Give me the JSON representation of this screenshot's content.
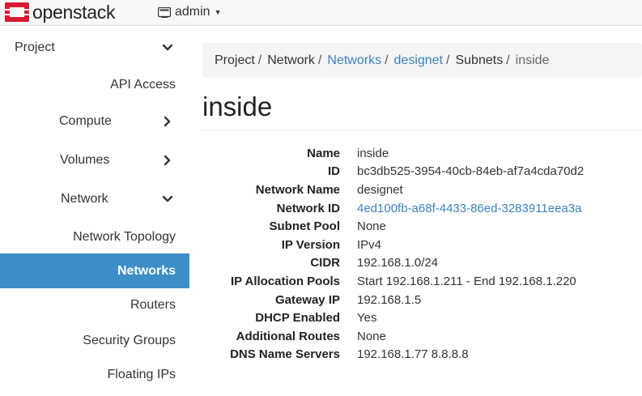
{
  "brand": {
    "logo_text": "openstack",
    "accent": "#da1a32"
  },
  "header": {
    "project_label": "admin"
  },
  "sidebar": {
    "active_color": "#3d8dc8",
    "items": [
      {
        "label": "Project"
      },
      {
        "label": "API Access"
      },
      {
        "label": "Compute"
      },
      {
        "label": "Volumes"
      },
      {
        "label": "Network"
      },
      {
        "label": "Network Topology"
      },
      {
        "label": "Networks"
      },
      {
        "label": "Routers"
      },
      {
        "label": "Security Groups"
      },
      {
        "label": "Floating IPs"
      }
    ]
  },
  "breadcrumb": [
    "Project",
    "Network",
    "Networks",
    "designet",
    "Subnets",
    "inside"
  ],
  "page": {
    "title": "inside"
  },
  "details": [
    {
      "label": "Name",
      "value": "inside"
    },
    {
      "label": "ID",
      "value": "bc3db525-3954-40cb-84eb-af7a4cda70d2"
    },
    {
      "label": "Network Name",
      "value": "designet"
    },
    {
      "label": "Network ID",
      "value": "4ed100fb-a68f-4433-86ed-3283911eea3a"
    },
    {
      "label": "Subnet Pool",
      "value": "None"
    },
    {
      "label": "IP Version",
      "value": "IPv4"
    },
    {
      "label": "CIDR",
      "value": "192.168.1.0/24"
    },
    {
      "label": "IP Allocation Pools",
      "value": "Start 192.168.1.211 - End 192.168.1.220"
    },
    {
      "label": "Gateway IP",
      "value": "192.168.1.5"
    },
    {
      "label": "DHCP Enabled",
      "value": "Yes"
    },
    {
      "label": "Additional Routes",
      "value": "None"
    },
    {
      "label": "DNS Name Servers",
      "value": "192.168.1.77 8.8.8.8"
    }
  ]
}
